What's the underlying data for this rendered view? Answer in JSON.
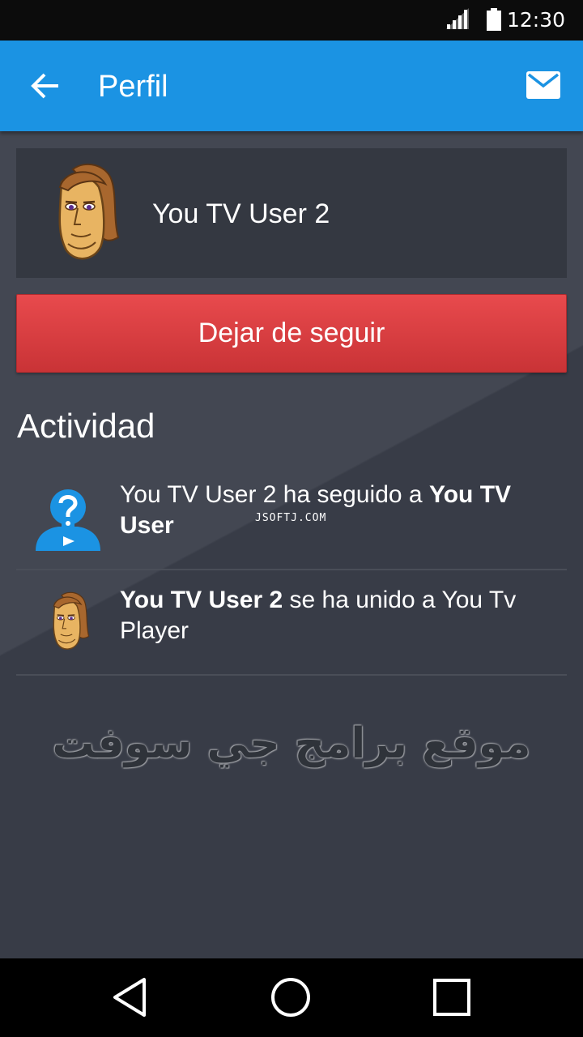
{
  "status_bar": {
    "time": "12:30",
    "signal_icon": "signal-icon",
    "battery_icon": "battery-icon"
  },
  "app_bar": {
    "title": "Perfil",
    "back_icon": "arrow-back-icon",
    "mail_icon": "mail-icon",
    "color": "#1b93e3"
  },
  "profile": {
    "name": "You TV User 2",
    "avatar_icon": "avatar-cartoon-face"
  },
  "unfollow_button": {
    "label": "Dejar de seguir",
    "color": "#d93f42"
  },
  "activity": {
    "title": "Actividad",
    "items": [
      {
        "icon": "unknown-user-icon",
        "prefix": "You TV User 2 ha seguido a ",
        "bold": "You TV User"
      },
      {
        "icon": "avatar-cartoon-face",
        "bold": "You TV User 2",
        "suffix": " se ha unido a You Tv Player"
      }
    ]
  },
  "watermarks": {
    "small": "JSOFTJ.COM",
    "arabic": "موقع برامج جي سوفت"
  },
  "nav_bar": {
    "back_icon": "nav-back-triangle-icon",
    "home_icon": "nav-home-circle-icon",
    "recents_icon": "nav-recents-square-icon"
  }
}
